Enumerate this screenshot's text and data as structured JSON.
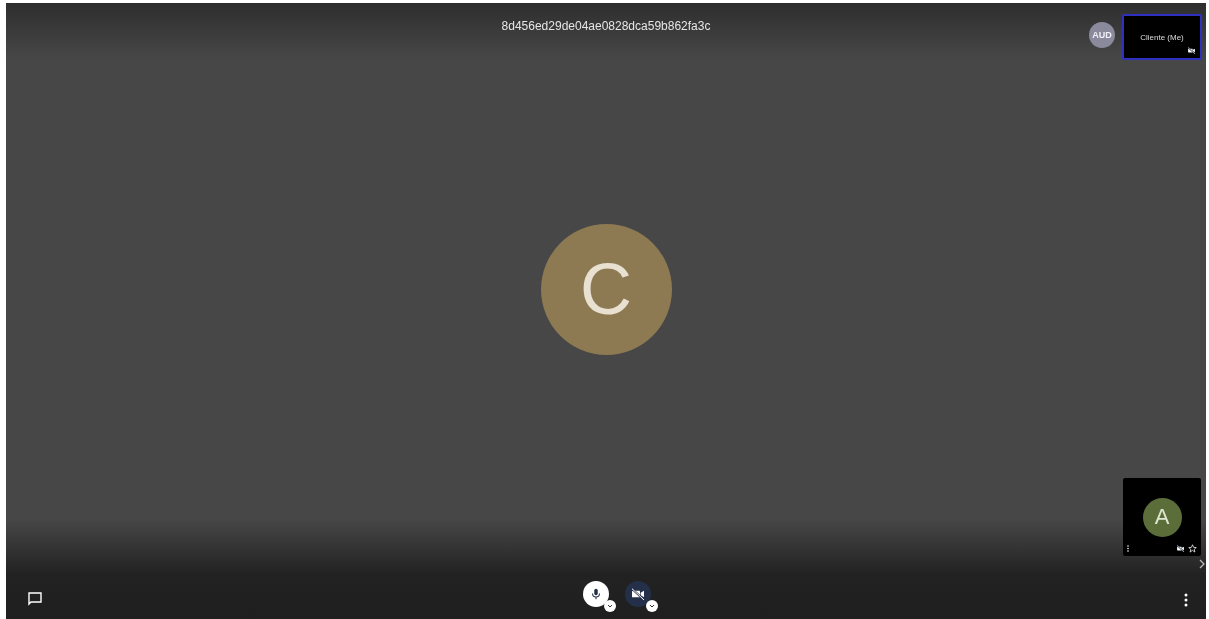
{
  "meeting_title": "8d456ed29de04ae0828dca59b862fa3c",
  "audio_badge": "AUD",
  "self_view": {
    "label": "Cliente (Me)",
    "camera_on": false
  },
  "main_speaker": {
    "initial": "C",
    "color": "#8d7a52"
  },
  "participant_tile": {
    "initial": "A",
    "color": "#5b6e3a",
    "camera_on": false,
    "starred": false
  },
  "controls": {
    "mic_on": true,
    "camera_on": false
  }
}
